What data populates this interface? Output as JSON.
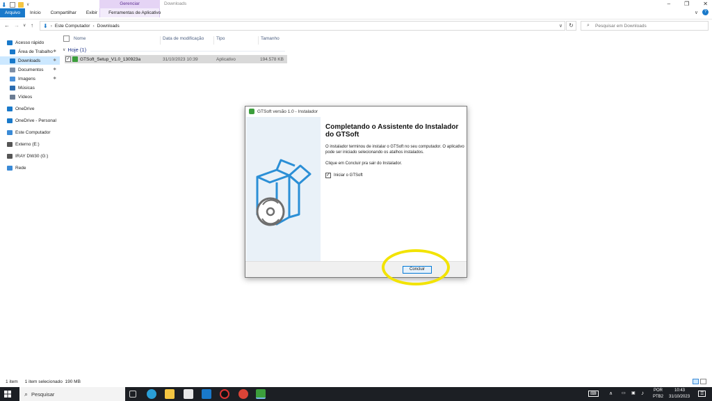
{
  "ribbon": {
    "context_group": "Gerenciar",
    "context_title": "Downloads",
    "tabs": [
      "Arquivo",
      "Início",
      "Compartilhar",
      "Exibir",
      "Ferramentas de Aplicativo"
    ]
  },
  "address": {
    "crumbs": [
      "Este Computador",
      "Downloads"
    ],
    "search_placeholder": "Pesquisar em Downloads"
  },
  "sidebar": {
    "items": [
      {
        "label": "Acesso rápido",
        "icon": "star-icon",
        "color": "#1979ca"
      },
      {
        "label": "Área de Trabalho",
        "icon": "desktop-icon",
        "color": "#1979ca",
        "pinned": true
      },
      {
        "label": "Downloads",
        "icon": "download-icon",
        "color": "#1979ca",
        "pinned": true,
        "selected": true
      },
      {
        "label": "Documentos",
        "icon": "documents-icon",
        "color": "#7f8fa6",
        "pinned": true
      },
      {
        "label": "Imagens",
        "icon": "images-icon",
        "color": "#4a90d9",
        "pinned": true
      },
      {
        "label": "Músicas",
        "icon": "music-icon",
        "color": "#2b6cb0"
      },
      {
        "label": "Vídeos",
        "icon": "videos-icon",
        "color": "#6b7c93"
      },
      {
        "label": "OneDrive",
        "icon": "cloud-icon",
        "color": "#1979ca"
      },
      {
        "label": "OneDrive - Personal",
        "icon": "cloud-icon",
        "color": "#1979ca"
      },
      {
        "label": "Este Computador",
        "icon": "computer-icon",
        "color": "#3a8ad6"
      },
      {
        "label": "Externo (E:)",
        "icon": "drive-icon",
        "color": "#555555"
      },
      {
        "label": "IRAY DW30 (G:)",
        "icon": "drive-icon",
        "color": "#555555"
      },
      {
        "label": "Rede",
        "icon": "network-icon",
        "color": "#3a8ad6"
      }
    ]
  },
  "columns": {
    "name": "Nome",
    "date": "Data de modificação",
    "type": "Tipo",
    "size": "Tamanho"
  },
  "group": {
    "label": "Hoje (1)"
  },
  "files": [
    {
      "name": "GTSoft_Setup_V1.0_130923a",
      "date": "31/10/2023 10:39",
      "type": "Aplicativo",
      "size": "194.578 KB"
    }
  ],
  "status": {
    "count": "1 item",
    "selection": "1 item selecionado  190 MB"
  },
  "dialog": {
    "title": "GTSoft versão 1.0 - Instalador",
    "heading": "Completando o Assistente do Instalador do GTSoft",
    "para1": "O instalador terminou de instalar o GTSoft no seu computador. O aplicativo pode ser iniciado selecionando os atalhos instalados.",
    "para2": "Clique em Concluir pra sair do Instalador.",
    "checkbox_label": "Iniciar o GTSoft",
    "checkbox_checked": true,
    "finish_button": "Concluir"
  },
  "taskbar": {
    "search_placeholder": "Pesquisar",
    "lang1": "POR",
    "lang2": "PTB2",
    "time": "10:43",
    "date": "31/10/2023"
  }
}
